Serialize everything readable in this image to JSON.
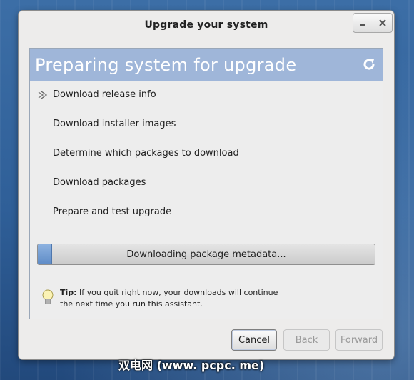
{
  "window": {
    "title": "Upgrade your system",
    "minimize_icon": "minimize-icon",
    "close_icon": "close-icon"
  },
  "banner": {
    "heading": "Preparing system for upgrade",
    "refresh_icon": "refresh-icon",
    "color": "#9fb6d9"
  },
  "steps": [
    {
      "label": "Download release info",
      "current": true
    },
    {
      "label": "Download installer images",
      "current": false
    },
    {
      "label": "Determine which packages to download",
      "current": false
    },
    {
      "label": "Download packages",
      "current": false
    },
    {
      "label": "Prepare and test upgrade",
      "current": false
    }
  ],
  "progress": {
    "text": "Downloading package metadata...",
    "fraction": 0.04
  },
  "tip": {
    "label": "Tip:",
    "line1": "If you quit right now, your downloads will continue",
    "line2": "the next time you run this assistant.",
    "icon": "lightbulb-icon"
  },
  "buttons": {
    "cancel": "Cancel",
    "back": "Back",
    "forward": "Forward"
  },
  "watermark": "双电网 (www. pcpc. me)"
}
